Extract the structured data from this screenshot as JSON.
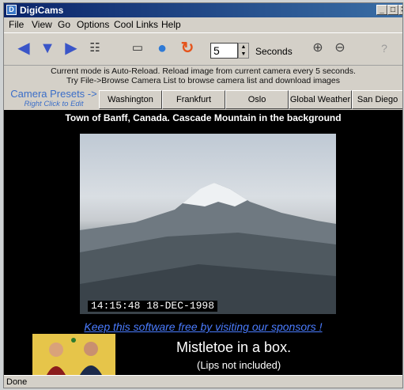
{
  "window": {
    "title": "DigiCams"
  },
  "titlebar": {
    "minimize": "_",
    "maximize": "□",
    "close": "✕"
  },
  "menu": [
    {
      "label": "File"
    },
    {
      "label": "View"
    },
    {
      "label": "Go"
    },
    {
      "label": "Options"
    },
    {
      "label": "Cool Links"
    },
    {
      "label": "Help"
    }
  ],
  "toolbar": {
    "interval_value": "5",
    "interval_unit": "Seconds",
    "icons": [
      "back-arrow-icon",
      "down-arrow-icon",
      "forward-arrow-icon",
      "camera-list-icon",
      "slideshow-icon",
      "globe-icon",
      "reload-icon",
      "zoom-in-icon",
      "zoom-out-icon",
      "help-icon"
    ]
  },
  "info": {
    "line1": "Current mode is Auto-Reload. Reload image from current camera every 5 seconds.",
    "line2": "Try File->Browse Camera List to browse camera list and download images"
  },
  "presets": {
    "label": "Camera Presets ->",
    "hint": "Right Click to Edit",
    "buttons": [
      "Washington",
      "Frankfurt",
      "Oslo",
      "Global Weather",
      "San Diego"
    ]
  },
  "camera": {
    "caption": "Town of Banff, Canada.  Cascade Mountain in the background",
    "timestamp": "14:15:48 18-DEC-1998"
  },
  "sponsor": {
    "link_text": "Keep this software free by visiting our sponsors !"
  },
  "ad": {
    "title": "Mistletoe in a box.",
    "subtitle": "(Lips not included)"
  },
  "status": {
    "text": "Done"
  },
  "colors": {
    "titlebar": "#0a246a",
    "display_bg": "#000000",
    "link": "#4a7cff",
    "preset_label": "#3b6ec8"
  }
}
